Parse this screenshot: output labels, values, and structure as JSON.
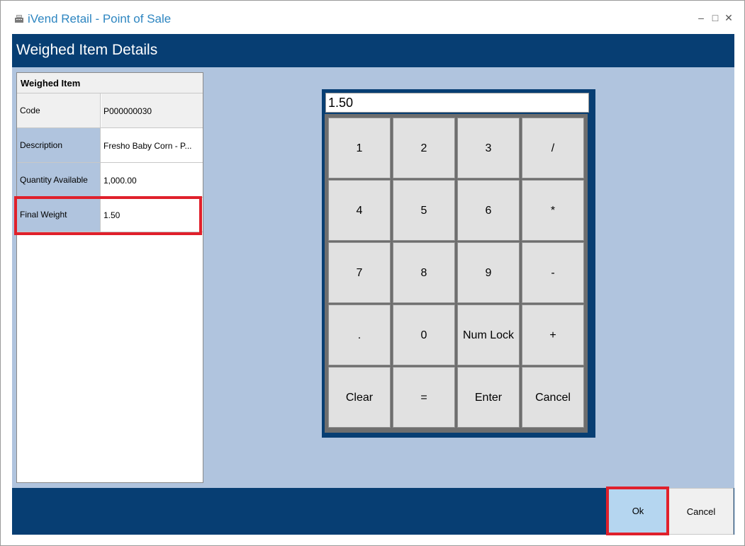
{
  "window": {
    "title": "iVend Retail - Point of Sale",
    "minimize": "–",
    "maximize": "□",
    "close": "✕"
  },
  "header": {
    "title": "Weighed Item Details"
  },
  "item_grid": {
    "header": "Weighed Item",
    "rows": [
      {
        "label": "Code",
        "value": "P000000030"
      },
      {
        "label": "Description",
        "value": "Fresho Baby Corn - P..."
      },
      {
        "label": "Quantity Available",
        "value": "1,000.00"
      },
      {
        "label": "Final Weight",
        "value": "1.50"
      }
    ]
  },
  "keypad": {
    "display_value": "1.50",
    "keys": [
      [
        "1",
        "2",
        "3",
        "/"
      ],
      [
        "4",
        "5",
        "6",
        "*"
      ],
      [
        "7",
        "8",
        "9",
        "-"
      ],
      [
        ".",
        "0",
        "Num Lock",
        "+"
      ],
      [
        "Clear",
        "=",
        "Enter",
        "Cancel"
      ]
    ]
  },
  "footer": {
    "ok_label": "Ok",
    "cancel_label": "Cancel"
  },
  "colors": {
    "header_blue": "#073e73",
    "content_bg": "#b0c4de",
    "title_blue": "#2e86c1",
    "highlight_red": "#e0202b",
    "ok_button_bg": "#b5d6f0"
  }
}
